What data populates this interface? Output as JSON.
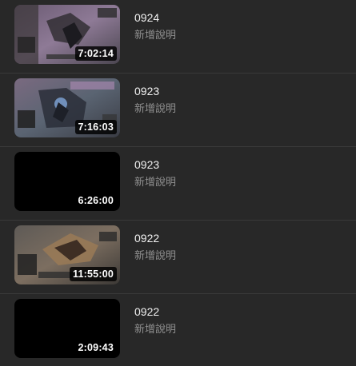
{
  "videos": [
    {
      "title": "0924",
      "description": "新增說明",
      "duration": "7:02:14",
      "thumbnail": "game-screenshot"
    },
    {
      "title": "0923",
      "description": "新增說明",
      "duration": "7:16:03",
      "thumbnail": "game-screenshot"
    },
    {
      "title": "0923",
      "description": "新增說明",
      "duration": "6:26:00",
      "thumbnail": "black"
    },
    {
      "title": "0922",
      "description": "新增說明",
      "duration": "11:55:00",
      "thumbnail": "game-screenshot"
    },
    {
      "title": "0922",
      "description": "新增說明",
      "duration": "2:09:43",
      "thumbnail": "black"
    }
  ],
  "colors": {
    "background": "#282828",
    "divider": "#3a3a3a",
    "title": "#f1f1f1",
    "description": "#8f8f8f"
  }
}
